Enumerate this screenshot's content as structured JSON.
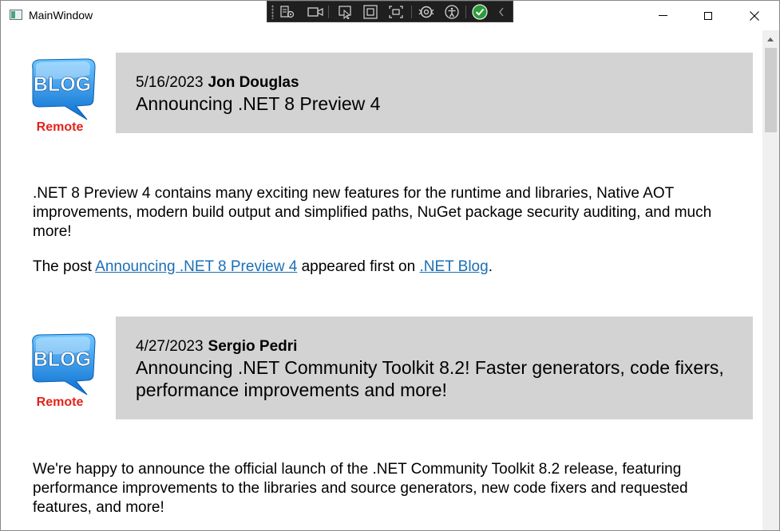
{
  "window": {
    "title": "MainWindow"
  },
  "devtools": {
    "icons": [
      "select-element-icon",
      "track-focus-icon",
      "video-icon",
      "element-picker-icon",
      "layout-adorner-icon",
      "display-layout-icon",
      "hot-reload-icon",
      "accessibility-icon",
      "check-icon",
      "collapse-chevron-icon"
    ]
  },
  "logo": {
    "badge_text": "BLOG",
    "caption": "Remote",
    "colors": {
      "badge": "#1e8fe6",
      "caption": "#e3231c"
    }
  },
  "posts": [
    {
      "date": "5/16/2023",
      "author": "Jon Douglas",
      "title": "Announcing .NET 8 Preview 4",
      "summary": ".NET 8 Preview 4 contains many exciting new features for the runtime and libraries, Native AOT improvements, modern build output and simplified paths, NuGet package security auditing, and much more!",
      "footer": {
        "prefix": "The post ",
        "post_link": "Announcing .NET 8 Preview 4",
        "middle": " appeared first on ",
        "blog_link": ".NET Blog",
        "suffix": "."
      }
    },
    {
      "date": "4/27/2023",
      "author": "Sergio Pedri",
      "title": "Announcing .NET Community Toolkit 8.2! Faster generators, code fixers, performance improvements and more!",
      "summary": "We're happy to announce the official launch of the .NET Community Toolkit 8.2 release, featuring performance improvements to the libraries and source generators, new code fixers and requested features, and more!"
    }
  ],
  "colors": {
    "header_background": "#d3d3d3",
    "link": "#1a6fb5"
  }
}
